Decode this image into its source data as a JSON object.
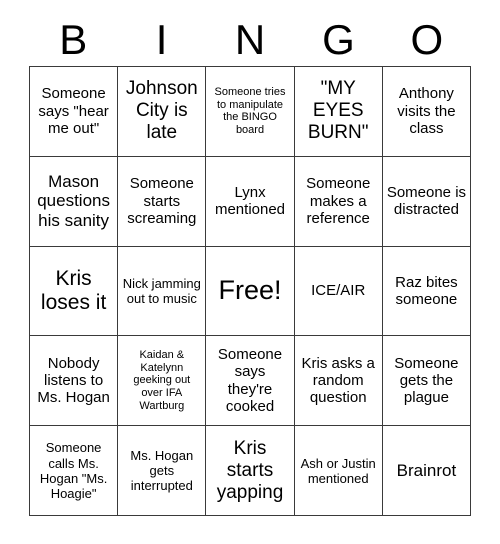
{
  "card": {
    "title": "BINGO",
    "header_letters": [
      "B",
      "I",
      "N",
      "G",
      "O"
    ],
    "rows": [
      [
        {
          "text": "Someone says \"hear me out\"",
          "size": "m"
        },
        {
          "text": "Johnson City is late",
          "size": "xl"
        },
        {
          "text": "Someone tries to manipulate the BINGO board",
          "size": "xs"
        },
        {
          "text": "\"MY EYES BURN\"",
          "size": "xl"
        },
        {
          "text": "Anthony visits the class",
          "size": "m"
        }
      ],
      [
        {
          "text": "Mason questions his sanity",
          "size": "l"
        },
        {
          "text": "Someone starts screaming",
          "size": "m"
        },
        {
          "text": "Lynx mentioned",
          "size": "m"
        },
        {
          "text": "Someone makes a reference",
          "size": "m"
        },
        {
          "text": "Someone is distracted",
          "size": "m"
        }
      ],
      [
        {
          "text": "Kris loses it",
          "size": "xxl"
        },
        {
          "text": "Nick jamming out to music",
          "size": "s"
        },
        {
          "text": "Free!",
          "size": "free"
        },
        {
          "text": "ICE/AIR",
          "size": "m"
        },
        {
          "text": "Raz bites someone",
          "size": "m"
        }
      ],
      [
        {
          "text": "Nobody listens to Ms. Hogan",
          "size": "m"
        },
        {
          "text": "Kaidan & Katelynn geeking out over IFA Wartburg",
          "size": "xs"
        },
        {
          "text": "Someone says they're cooked",
          "size": "m"
        },
        {
          "text": "Kris asks a random question",
          "size": "m"
        },
        {
          "text": "Someone gets the plague",
          "size": "m"
        }
      ],
      [
        {
          "text": "Someone calls Ms. Hogan \"Ms. Hoagie\"",
          "size": "s"
        },
        {
          "text": "Ms. Hogan gets interrupted",
          "size": "s"
        },
        {
          "text": "Kris starts yapping",
          "size": "xl"
        },
        {
          "text": "Ash or Justin mentioned",
          "size": "s"
        },
        {
          "text": "Brainrot",
          "size": "l"
        }
      ]
    ],
    "colors": {
      "background": "#ffffff",
      "text": "#000000",
      "grid_line": "#3a3a3a"
    }
  }
}
